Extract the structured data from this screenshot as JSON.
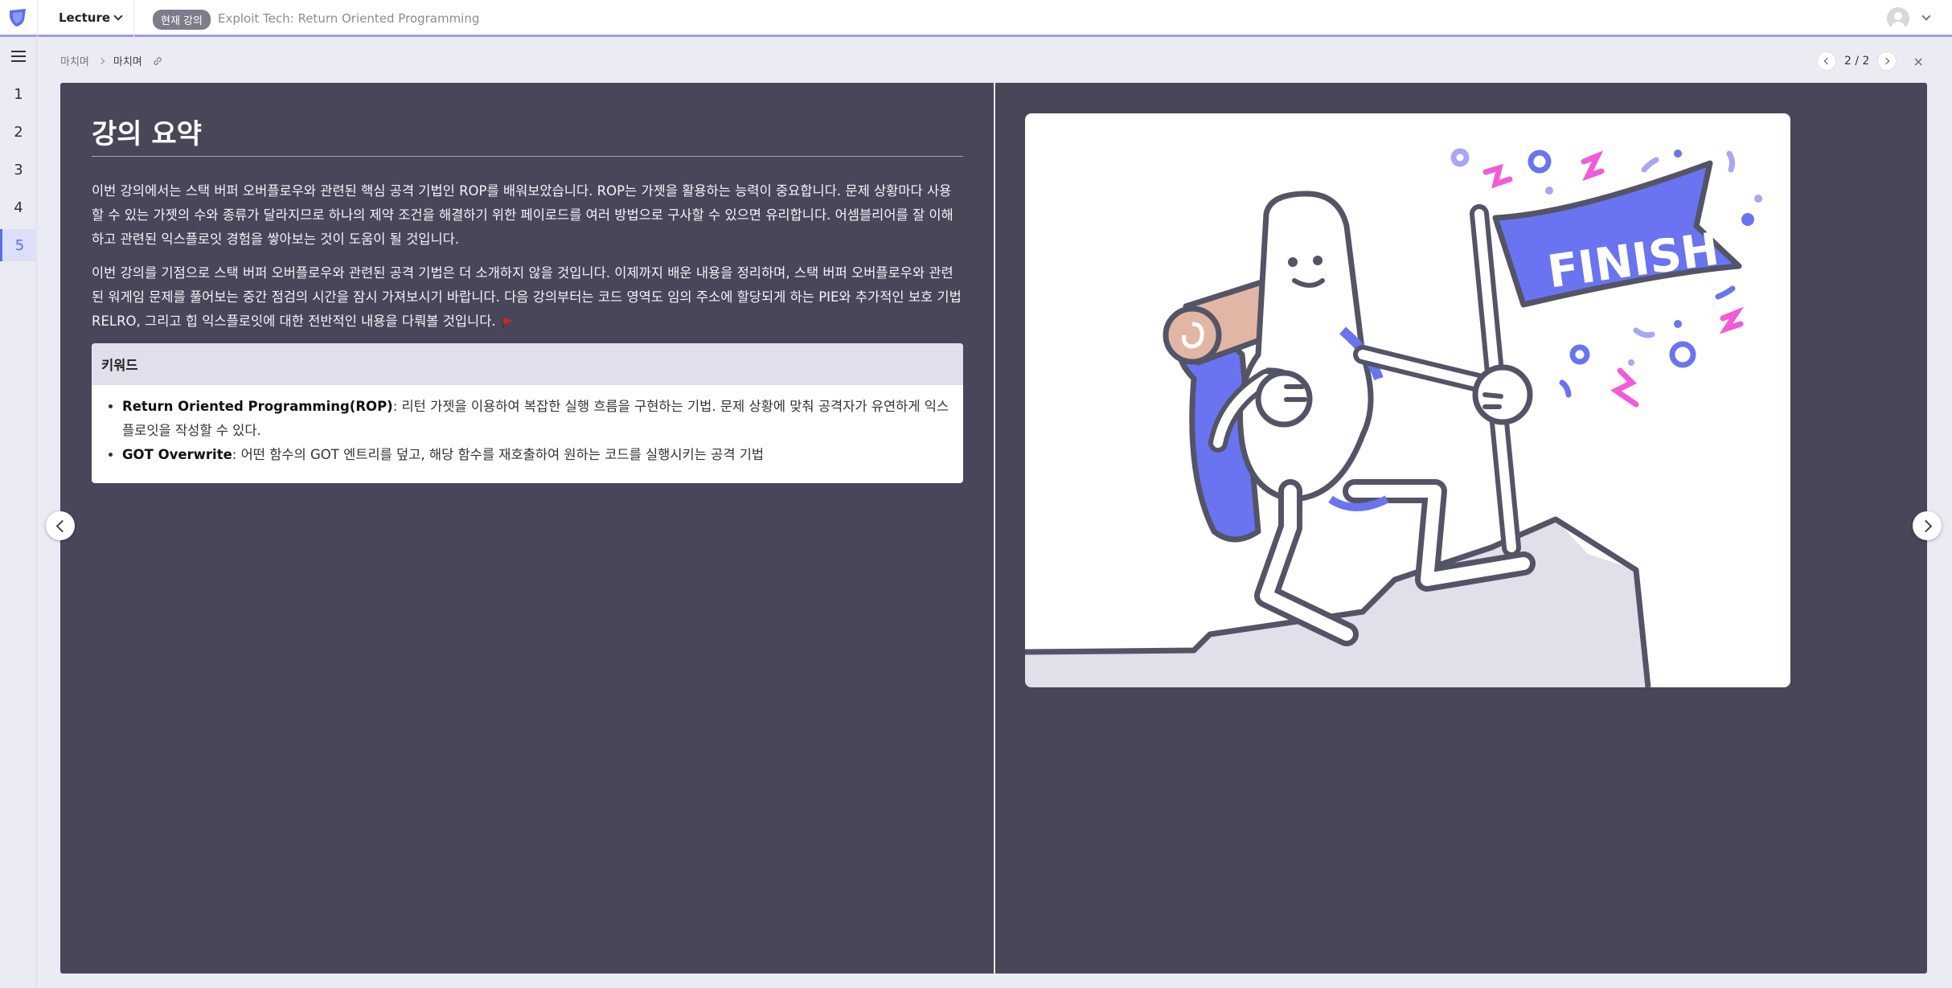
{
  "header": {
    "lecture_label": "Lecture",
    "current_badge": "현재 강의",
    "course_title": "Exploit Tech: Return Oriented Programming"
  },
  "sidebar": {
    "pages": [
      "1",
      "2",
      "3",
      "4",
      "5"
    ],
    "active_page": "5"
  },
  "breadcrumb": {
    "parent": "마치며",
    "current": "마치며"
  },
  "pager": {
    "label": "2 / 2",
    "close": "×"
  },
  "slide": {
    "title": "강의 요약",
    "paragraph1": "이번 강의에서는 스택 버퍼 오버플로우와 관련된 핵심 공격 기법인 ROP를 배워보았습니다. ROP는 가젯을 활용하는 능력이 중요합니다. 문제 상황마다 사용할 수 있는 가젯의 수와 종류가 달라지므로 하나의 제약 조건을 해결하기 위한 페이로드를 여러 방법으로 구사할 수 있으면 유리합니다. 어셈블리어를 잘 이해하고 관련된 익스플로잇 경험을 쌓아보는 것이 도움이 될 것입니다.",
    "paragraph2": "이번 강의를 기점으로 스택 버퍼 오버플로우와 관련된 공격 기법은 더 소개하지 않을 것입니다. 이제까지 배운 내용을 정리하며, 스택 버퍼 오버플로우와 관련된 워게임 문제를 풀어보는 중간 점검의 시간을 잠시 가져보시기 바랍니다. 다음 강의부터는 코드 영역도 임의 주소에 할당되게 하는 PIE와 추가적인 보호 기법 RELRO, 그리고 힙 익스플로잇에 대한 전반적인 내용을 다뤄볼 것입니다.",
    "keyword_header": "키워드",
    "keywords": [
      {
        "term": "Return Oriented Programming(ROP)",
        "desc": ": 리턴 가젯을 이용하여 복잡한 실행 흐름을 구현하는 기법. 문제 상황에 맞춰 공격자가 유연하게 익스플로잇을 작성할 수 있다."
      },
      {
        "term": "GOT Overwrite",
        "desc": ": 어떤 함수의 GOT 엔트리를 덮고, 해당 함수를 재호출하여 원하는 코드를 실행시키는 공격 기법"
      }
    ],
    "illustration_flag_text": "FINISH"
  },
  "colors": {
    "accent": "#5b6fe8",
    "slide_bg": "#484759",
    "flag_blue": "#6a74f0",
    "confetti_pink": "#f25bd8"
  },
  "icons": [
    "dreamhack-logo-icon",
    "chevron-down-icon",
    "menu-icon",
    "chevron-right-icon",
    "link-icon",
    "chevron-left-icon",
    "close-icon",
    "user-avatar-icon",
    "red-flag-icon"
  ]
}
